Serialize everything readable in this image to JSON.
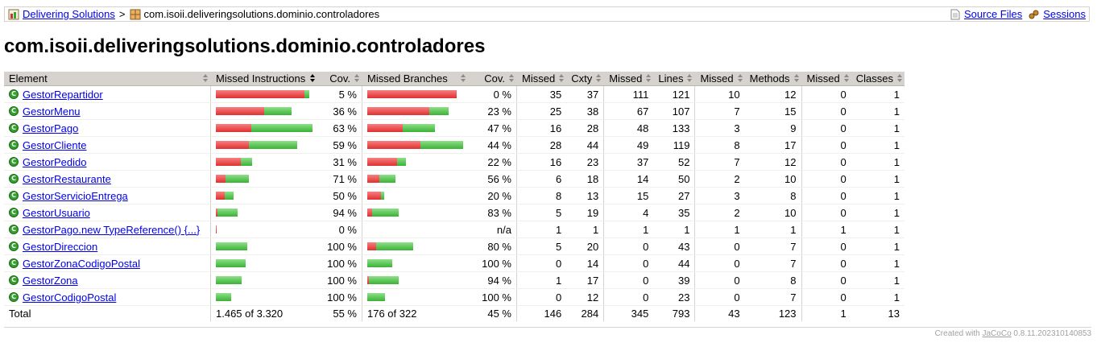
{
  "breadcrumb": {
    "project_link": "Delivering Solutions",
    "separator": ">",
    "package": "com.isoii.deliveringsolutions.dominio.controladores",
    "source_files": "Source Files",
    "sessions": "Sessions"
  },
  "page_title": "com.isoii.deliveringsolutions.dominio.controladores",
  "table": {
    "headers": {
      "element": "Element",
      "missed_instructions": "Missed Instructions",
      "cov1": "Cov.",
      "missed_branches": "Missed Branches",
      "cov2": "Cov.",
      "missed_cxty": "Missed",
      "cxty": "Cxty",
      "missed_lines": "Missed",
      "lines": "Lines",
      "missed_methods": "Missed",
      "methods": "Methods",
      "missed_classes": "Missed",
      "classes": "Classes"
    },
    "rows": [
      {
        "name": "GestorRepartidor",
        "ins_red": 110,
        "ins_green": 6,
        "ins_cov": "5 %",
        "br_red": 111,
        "br_green": 0,
        "br_cov": "0 %",
        "mc": "35",
        "c": "37",
        "ml": "111",
        "l": "121",
        "mm": "10",
        "m": "12",
        "mcl": "0",
        "cl": "1"
      },
      {
        "name": "GestorMenu",
        "ins_red": 60,
        "ins_green": 34,
        "ins_cov": "36 %",
        "br_red": 77,
        "br_green": 24,
        "br_cov": "23 %",
        "mc": "25",
        "c": "38",
        "ml": "67",
        "l": "107",
        "mm": "7",
        "m": "15",
        "mcl": "0",
        "cl": "1"
      },
      {
        "name": "GestorPago",
        "ins_red": 44,
        "ins_green": 76,
        "ins_cov": "63 %",
        "br_red": 44,
        "br_green": 40,
        "br_cov": "47 %",
        "mc": "16",
        "c": "28",
        "ml": "48",
        "l": "133",
        "mm": "3",
        "m": "9",
        "mcl": "0",
        "cl": "1"
      },
      {
        "name": "GestorCliente",
        "ins_red": 41,
        "ins_green": 60,
        "ins_cov": "59 %",
        "br_red": 66,
        "br_green": 53,
        "br_cov": "44 %",
        "mc": "28",
        "c": "44",
        "ml": "49",
        "l": "119",
        "mm": "8",
        "m": "17",
        "mcl": "0",
        "cl": "1"
      },
      {
        "name": "GestorPedido",
        "ins_red": 31,
        "ins_green": 14,
        "ins_cov": "31 %",
        "br_red": 37,
        "br_green": 11,
        "br_cov": "22 %",
        "mc": "16",
        "c": "23",
        "ml": "37",
        "l": "52",
        "mm": "7",
        "m": "12",
        "mcl": "0",
        "cl": "1"
      },
      {
        "name": "GestorRestaurante",
        "ins_red": 12,
        "ins_green": 29,
        "ins_cov": "71 %",
        "br_red": 15,
        "br_green": 20,
        "br_cov": "56 %",
        "mc": "6",
        "c": "18",
        "ml": "14",
        "l": "50",
        "mm": "2",
        "m": "10",
        "mcl": "0",
        "cl": "1"
      },
      {
        "name": "GestorServicioEntrega",
        "ins_red": 11,
        "ins_green": 11,
        "ins_cov": "50 %",
        "br_red": 17,
        "br_green": 4,
        "br_cov": "20 %",
        "mc": "8",
        "c": "13",
        "ml": "15",
        "l": "27",
        "mm": "3",
        "m": "8",
        "mcl": "0",
        "cl": "1"
      },
      {
        "name": "GestorUsuario",
        "ins_red": 2,
        "ins_green": 25,
        "ins_cov": "94 %",
        "br_red": 6,
        "br_green": 33,
        "br_cov": "83 %",
        "mc": "5",
        "c": "19",
        "ml": "4",
        "l": "35",
        "mm": "2",
        "m": "10",
        "mcl": "0",
        "cl": "1"
      },
      {
        "name": "GestorPago.new TypeReference() {...}",
        "ins_red": 1,
        "ins_green": 0,
        "ins_cov": "0 %",
        "br_red": 0,
        "br_green": 0,
        "br_cov": "n/a",
        "mc": "1",
        "c": "1",
        "ml": "1",
        "l": "1",
        "mm": "1",
        "m": "1",
        "mcl": "1",
        "cl": "1"
      },
      {
        "name": "GestorDireccion",
        "ins_red": 0,
        "ins_green": 39,
        "ins_cov": "100 %",
        "br_red": 11,
        "br_green": 46,
        "br_cov": "80 %",
        "mc": "5",
        "c": "20",
        "ml": "0",
        "l": "43",
        "mm": "0",
        "m": "7",
        "mcl": "0",
        "cl": "1"
      },
      {
        "name": "GestorZonaCodigoPostal",
        "ins_red": 0,
        "ins_green": 37,
        "ins_cov": "100 %",
        "br_red": 0,
        "br_green": 31,
        "br_cov": "100 %",
        "mc": "0",
        "c": "14",
        "ml": "0",
        "l": "44",
        "mm": "0",
        "m": "7",
        "mcl": "0",
        "cl": "1"
      },
      {
        "name": "GestorZona",
        "ins_red": 0,
        "ins_green": 32,
        "ins_cov": "100 %",
        "br_red": 2,
        "br_green": 37,
        "br_cov": "94 %",
        "mc": "1",
        "c": "17",
        "ml": "0",
        "l": "39",
        "mm": "0",
        "m": "8",
        "mcl": "0",
        "cl": "1"
      },
      {
        "name": "GestorCodigoPostal",
        "ins_red": 0,
        "ins_green": 19,
        "ins_cov": "100 %",
        "br_red": 0,
        "br_green": 22,
        "br_cov": "100 %",
        "mc": "0",
        "c": "12",
        "ml": "0",
        "l": "23",
        "mm": "0",
        "m": "7",
        "mcl": "0",
        "cl": "1"
      }
    ],
    "total": {
      "label": "Total",
      "ins": "1.465 of 3.320",
      "ins_cov": "55 %",
      "br": "176 of 322",
      "br_cov": "45 %",
      "mc": "146",
      "c": "284",
      "ml": "345",
      "l": "793",
      "mm": "43",
      "m": "123",
      "mcl": "1",
      "cl": "13"
    }
  },
  "footer": {
    "prefix": "Created with",
    "link": "JaCoCo",
    "version": "0.8.11.202310140853"
  },
  "colors": {
    "covered": "#3bb236",
    "missed": "#e03030",
    "header": "#d6d3ce"
  }
}
